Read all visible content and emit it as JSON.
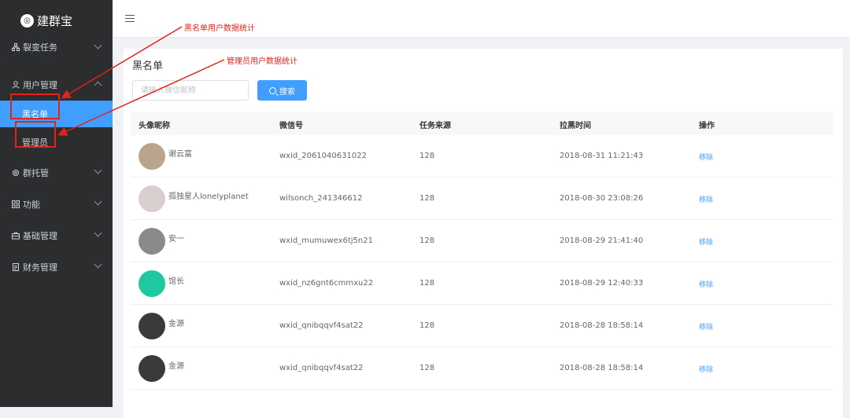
{
  "app": {
    "name": "建群宝"
  },
  "sidebar": {
    "items": [
      {
        "label": "裂变任务",
        "icon": "network-icon",
        "expanded": false
      },
      {
        "label": "用户管理",
        "icon": "user-icon",
        "expanded": true,
        "children": [
          {
            "label": "黑名单",
            "active": true
          },
          {
            "label": "管理员",
            "active": false
          }
        ]
      },
      {
        "label": "群托管",
        "icon": "gear-icon",
        "expanded": false
      },
      {
        "label": "功能",
        "icon": "grid-icon",
        "expanded": false
      },
      {
        "label": "基础管理",
        "icon": "briefcase-icon",
        "expanded": false
      },
      {
        "label": "财务管理",
        "icon": "document-icon",
        "expanded": false
      }
    ]
  },
  "page": {
    "title": "黑名单",
    "search": {
      "placeholder": "请输入微信昵称",
      "value": "",
      "button_label": "搜索"
    }
  },
  "table": {
    "columns": [
      "头像昵称",
      "微信号",
      "任务来源",
      "拉黑时间",
      "操作"
    ],
    "rows": [
      {
        "nickname": "谢云富",
        "wxid": "wxid_2061040631022",
        "source": "128",
        "time": "2018-08-31 11:21:43",
        "action": "移除",
        "avatar_color": "#b9a48c"
      },
      {
        "nickname": "孤独星人lonelyplanet",
        "wxid": "wilsonch_241346612",
        "source": "128",
        "time": "2018-08-30 23:08:26",
        "action": "移除",
        "avatar_color": "#d9cfcf"
      },
      {
        "nickname": "安一",
        "wxid": "wxid_mumuwex6tj5n21",
        "source": "128",
        "time": "2018-08-29 21:41:40",
        "action": "移除",
        "avatar_color": "#8a8a8a"
      },
      {
        "nickname": "馆长",
        "wxid": "wxid_nz6gnt6cmmxu22",
        "source": "128",
        "time": "2018-08-29 12:40:33",
        "action": "移除",
        "avatar_color": "#1fc8a0"
      },
      {
        "nickname": "金源",
        "wxid": "wxid_qnibqqvf4sat22",
        "source": "128",
        "time": "2018-08-28 18:58:14",
        "action": "移除",
        "avatar_color": "#3a3a3a"
      },
      {
        "nickname": "金源",
        "wxid": "wxid_qnibqqvf4sat22",
        "source": "128",
        "time": "2018-08-28 18:58:14",
        "action": "移除",
        "avatar_color": "#3a3a3a"
      }
    ]
  },
  "annotations": {
    "blacklist_note": "黑名单用户数据统计",
    "admin_note": "管理员用户数据统计",
    "color": "#e2231a"
  },
  "colors": {
    "sidebar_bg": "#2b2d2f",
    "accent": "#409eff"
  }
}
